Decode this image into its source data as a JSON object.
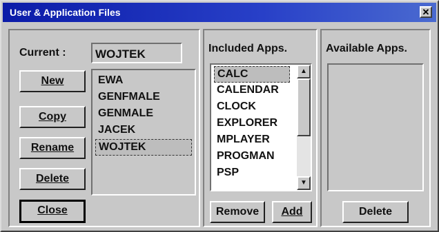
{
  "window": {
    "title": "User & Application Files",
    "close_glyph": "✕"
  },
  "current": {
    "label": "Current :",
    "value": "WOJTEK"
  },
  "user_buttons": {
    "new": "New",
    "copy": "Copy",
    "rename": "Rename",
    "delete": "Delete",
    "close": "Close"
  },
  "users": [
    "EWA",
    "GENFMALE",
    "GENMALE",
    "JACEK",
    "WOJTEK"
  ],
  "selected_user_index": 4,
  "included": {
    "header": "Included Apps.",
    "items": [
      "CALC",
      "CALENDAR",
      "CLOCK",
      "EXPLORER",
      "MPLAYER",
      "PROGMAN",
      "PSP"
    ],
    "remove_label": "Remove",
    "add_label": "Add"
  },
  "available": {
    "header": "Available Apps.",
    "items": [],
    "delete_label": "Delete"
  },
  "icons": {
    "scroll_up": "scroll-up-icon",
    "scroll_down": "scroll-down-icon",
    "close": "close-icon"
  }
}
